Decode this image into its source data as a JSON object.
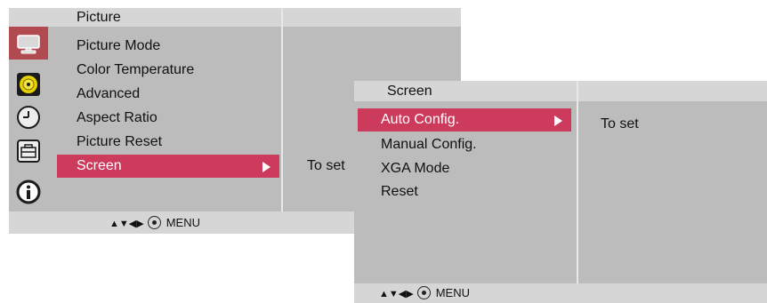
{
  "main_menu": {
    "title": "Picture",
    "items": [
      {
        "label": "Picture Mode"
      },
      {
        "label": "Color Temperature"
      },
      {
        "label": "Advanced"
      },
      {
        "label": "Aspect Ratio"
      },
      {
        "label": "Picture Reset"
      },
      {
        "label": "Screen",
        "selected": true
      }
    ],
    "right_text": "To set",
    "footer_nav": "▲▼◀▶",
    "footer_label": "MENU",
    "icons": [
      "monitor-icon",
      "disc-icon",
      "clock-icon",
      "toolbox-icon",
      "info-icon"
    ]
  },
  "sub_menu": {
    "title": "Screen",
    "items": [
      {
        "label": "Auto Config.",
        "selected": true
      },
      {
        "label": "Manual Config."
      },
      {
        "label": "XGA Mode"
      },
      {
        "label": "Reset"
      }
    ],
    "right_text": "To set",
    "footer_nav": "▲▼◀▶",
    "footer_label": "MENU"
  },
  "colors": {
    "panel": "#bcbcbc",
    "header": "#d6d6d6",
    "selected": "#cc3a5c",
    "active_icon_bg": "#b24a52"
  }
}
